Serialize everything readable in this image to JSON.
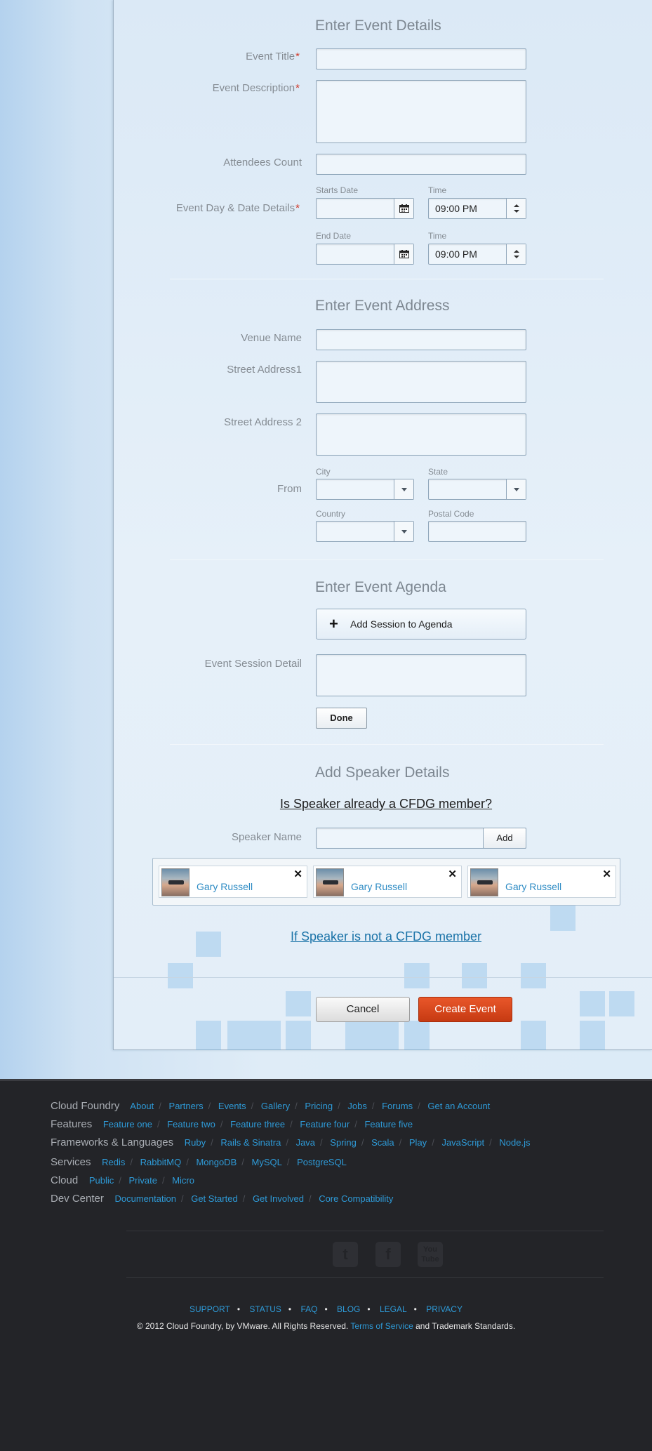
{
  "event_details": {
    "heading": "Enter Event Details",
    "event_title_label": "Event Title",
    "event_description_label": "Event Description",
    "attendees_label": "Attendees Count",
    "day_date_label": "Event Day & Date Details",
    "starts_date_label": "Starts Date",
    "start_time_label": "Time",
    "start_time_value": "09:00 PM",
    "end_date_label": "End Date",
    "end_time_label": "Time",
    "end_time_value": "09:00 PM",
    "required_mark": "*"
  },
  "event_address": {
    "heading": "Enter Event Address",
    "venue_label": "Venue Name",
    "street1_label": "Street Address1",
    "street2_label": "Street Address 2",
    "from_label": "From",
    "city_label": "City",
    "state_label": "State",
    "country_label": "Country",
    "postal_label": "Postal Code"
  },
  "event_agenda": {
    "heading": "Enter Event Agenda",
    "add_session_label": "Add Session to Agenda",
    "session_detail_label": "Event Session Detail",
    "done_label": "Done"
  },
  "speaker": {
    "heading": "Add Speaker Details",
    "member_question": "Is Speaker already a CFDG member?",
    "name_label": "Speaker Name",
    "add_label": "Add",
    "cards": [
      {
        "name": "Gary Russell"
      },
      {
        "name": "Gary Russell"
      },
      {
        "name": "Gary Russell"
      }
    ],
    "not_member_link": "If Speaker is not a CFDG member"
  },
  "actions": {
    "cancel_label": "Cancel",
    "create_label": "Create Event"
  },
  "footer": {
    "rows": [
      {
        "heading": "Cloud Foundry",
        "links": [
          "About",
          "Partners",
          "Events",
          "Gallery",
          "Pricing",
          "Jobs",
          "Forums",
          "Get an Account"
        ]
      },
      {
        "heading": "Features",
        "links": [
          "Feature one",
          "Feature two",
          "Feature three",
          "Feature four",
          "Feature five"
        ]
      },
      {
        "heading": "Frameworks & Languages",
        "links": [
          "Ruby",
          "Rails & Sinatra",
          "Java",
          "Spring",
          "Scala",
          "Play",
          "JavaScript",
          "Node.js"
        ]
      },
      {
        "heading": "Services",
        "links": [
          "Redis",
          "RabbitMQ",
          "MongoDB",
          "MySQL",
          "PostgreSQL"
        ]
      },
      {
        "heading": "Cloud",
        "links": [
          "Public",
          "Private",
          "Micro"
        ]
      },
      {
        "heading": "Dev Center",
        "links": [
          "Documentation",
          "Get Started",
          "Get Involved",
          "Core Compatibility"
        ]
      }
    ],
    "social_icons": [
      "twitter-icon",
      "facebook-icon",
      "youtube-icon"
    ],
    "bottom_links": [
      "SUPPORT",
      "STATUS",
      "FAQ",
      "BLOG",
      "LEGAL",
      "PRIVACY"
    ],
    "copyright_prefix": "© 2012 Cloud Foundry, by VMware. All Rights Reserved.",
    "terms_link": "Terms of Service",
    "copyright_suffix": "and Trademark Standards."
  },
  "colors": {
    "accent_link": "#2e9ad7",
    "create_button": "#d44b1f",
    "required": "#d13a2a"
  }
}
